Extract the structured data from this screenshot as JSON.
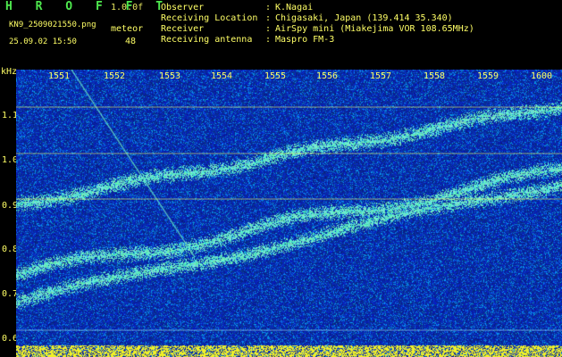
{
  "header": {
    "brand": "H R O F F T",
    "version": "1.0.0f",
    "filename": "KN9_2509021550.png",
    "datetime": "25.09.02 15:50",
    "meteor_label": "meteor",
    "meteor_count": "48"
  },
  "info": [
    {
      "label": "Observer",
      "value": "K.Nagai"
    },
    {
      "label": "Receiving Location",
      "value": "Chigasaki, Japan (139.414 35.340)"
    },
    {
      "label": "Receiver",
      "value": "AirSpy mini (Miakejima VOR 108.65MHz)"
    },
    {
      "label": "Receiving antenna",
      "value": "Maspro FM-3"
    }
  ],
  "axis": {
    "y_unit": "kHz",
    "y_ticks": [
      "1.1",
      "1.0",
      "0.9",
      "0.8",
      "0.7",
      "0.6"
    ],
    "x_ticks": [
      "1551",
      "1552",
      "1553",
      "1554",
      "1555",
      "1556",
      "1557",
      "1558",
      "1559",
      "1600"
    ]
  },
  "colors": {
    "background": "#000000",
    "spectrogram_base": "#0a1a8c",
    "signal": "#3fe0c0",
    "text": "#ffff66",
    "brand": "#4ee84e"
  }
}
